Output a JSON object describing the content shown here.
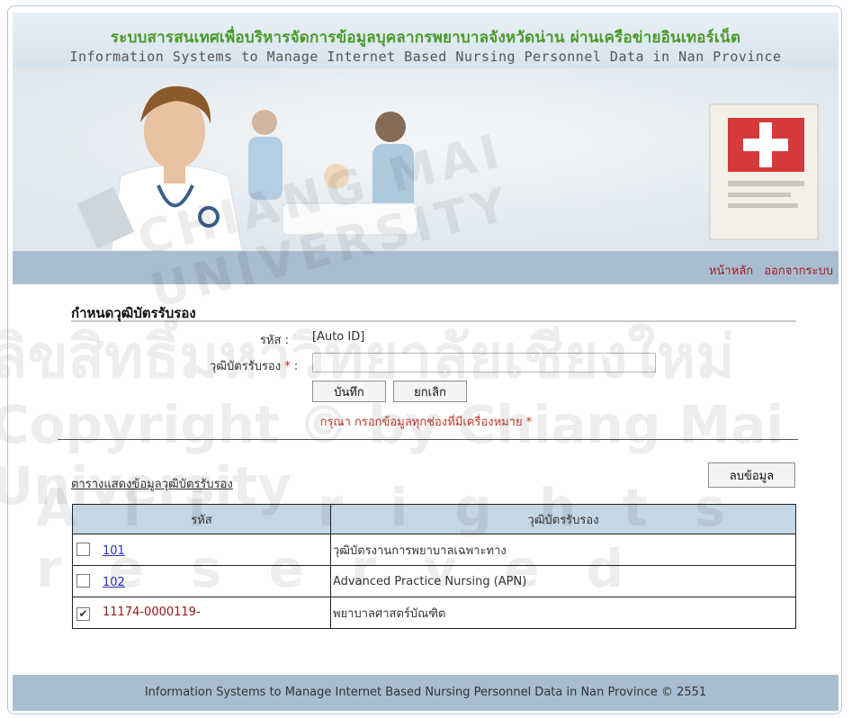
{
  "header": {
    "title_th": "ระบบสารสนเทศเพื่อบริหารจัดการข้อมูลบุคลากรพยาบาลจังหวัดน่าน ผ่านเครือข่ายอินเทอร์เน็ต",
    "title_en": "Information Systems to Manage Internet Based Nursing Personnel Data  in Nan Province"
  },
  "nav": {
    "home": "หน้าหลัก",
    "logout": "ออกจากระบบ"
  },
  "form": {
    "section_title": "กำหนดวุฒิบัตรรับรอง",
    "code_label": "รหัส :",
    "code_value": "[Auto ID]",
    "cert_label": "วุฒิบัตรรับรอง",
    "required_mark": "*",
    "colon": ":",
    "cert_value": "",
    "save_label": "บันทึก",
    "cancel_label": "ยกเลิก",
    "warning": "กรุณา กรอกข้อมูลทุกช่องที่มีเครื่องหมาย *"
  },
  "table": {
    "title": "ตารางแสดงข้อมูลวุฒิบัตรรับรอง",
    "delete_label": "ลบข้อมูล",
    "headers": [
      "รหัส",
      "วุฒิบัตรรับรอง"
    ],
    "rows": [
      {
        "code": "101",
        "name": "วุฒิบัตรงานการพยาบาลเฉพาะทาง",
        "checked": false
      },
      {
        "code": "102",
        "name": "Advanced Practice Nursing (APN)",
        "checked": false
      },
      {
        "code": "11174-0000119-",
        "name": "พยาบาลศาสตร์บัณฑิต",
        "checked": true
      }
    ]
  },
  "footer": {
    "text": "Information Systems to Manage Internet Based Nursing Personnel Data in Nan Province © 2551"
  },
  "watermark": {
    "line1": "ลิขสิทธิ์มหาวิทยาลัยเชียงใหม่",
    "line2": "Copyright © by Chiang Mai University",
    "line3": "All rights reserved",
    "arc": "CHIANG MAI UNIVERSITY"
  },
  "colors": {
    "accent_green": "#4c9a2a",
    "nav_bar": "#a9bdd0",
    "link_blue": "#2b2fb8",
    "nav_red": "#9b1c1c"
  }
}
